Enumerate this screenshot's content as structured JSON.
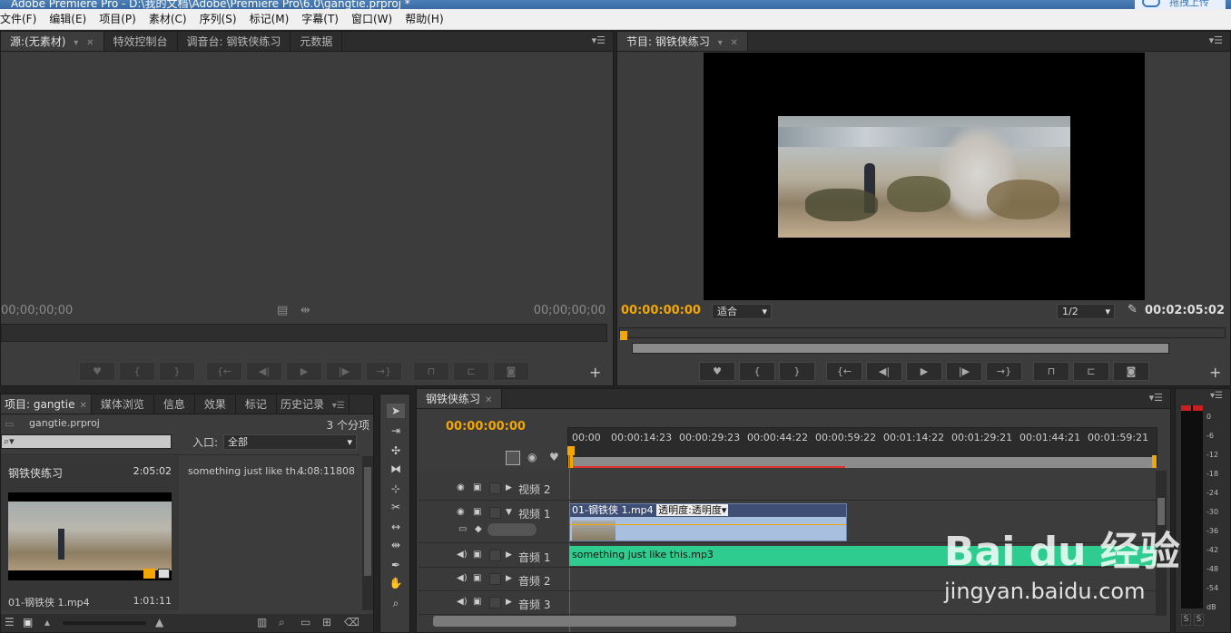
{
  "window": {
    "title": "Adobe Premiere Pro - D:\\我的文档\\Adobe\\Premiere Pro\\6.0\\gangtie.prproj *",
    "upload_label": "拖拽上传"
  },
  "menu": [
    "文件(F)",
    "编辑(E)",
    "项目(P)",
    "素材(C)",
    "序列(S)",
    "标记(M)",
    "字幕(T)",
    "窗口(W)",
    "帮助(H)"
  ],
  "source_panel": {
    "tabs": [
      "源:(无素材)",
      "特效控制台",
      "调音台: 钢铁侠练习",
      "元数据"
    ],
    "timecode_left": "00;00;00;00",
    "timecode_right": "00;00;00;00"
  },
  "program_panel": {
    "tab": "节目: 钢铁侠练习",
    "timecode_current": "00:00:00:00",
    "fit_option": "适合",
    "resolution": "1/2",
    "duration": "00:02:05:02"
  },
  "project_panel": {
    "tabs": [
      "项目: gangtie",
      "媒体浏览",
      "信息",
      "效果",
      "标记",
      "历史记录"
    ],
    "project_file": "gangtie.prproj",
    "item_count": "3 个分项",
    "in_label": "入口:",
    "in_value": "全部",
    "items": [
      {
        "name": "钢铁侠练习",
        "duration": "2:05:02"
      },
      {
        "name": "something just like th...",
        "duration": "4:08:11808"
      },
      {
        "name": "01-钢铁侠 1.mp4",
        "duration": "1:01:11"
      }
    ]
  },
  "timeline": {
    "tab": "钢铁侠练习",
    "timecode": "00:00:00:00",
    "ruler": [
      "00:00",
      "00:00:14:23",
      "00:00:29:23",
      "00:00:44:22",
      "00:00:59:22",
      "00:01:14:22",
      "00:01:29:21",
      "00:01:44:21",
      "00:01:59:21"
    ],
    "tracks": {
      "video2": "视频 2",
      "video1": "视频 1",
      "audio1": "音频 1",
      "audio2": "音频 2",
      "audio3": "音频 3"
    },
    "video_clip": {
      "name": "01-钢铁侠 1.mp4",
      "effect": "透明度:透明度"
    },
    "audio_clip": {
      "name": "something just like this.mp3"
    }
  },
  "audio_meter": {
    "scale": [
      "0",
      "-6",
      "-12",
      "-18",
      "-24",
      "-30",
      "-36",
      "-42",
      "-48",
      "-54",
      "dB"
    ],
    "solo": [
      "S",
      "S"
    ]
  },
  "watermark": {
    "brand": "Bai du 经验",
    "url": "jingyan.baidu.com"
  },
  "colors": {
    "accent": "#f2a700",
    "audio_clip": "#2ecc8f",
    "video_clip": "#a9bfe0",
    "playhead": "#e03030"
  }
}
